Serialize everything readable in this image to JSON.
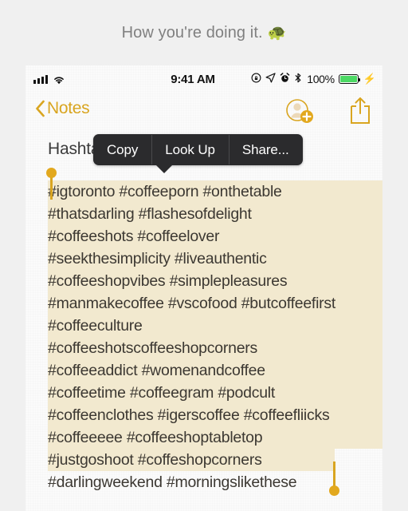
{
  "caption": {
    "text": "How you're doing it.",
    "emoji": "🐢",
    "emoji_name": "turtle-emoji",
    "color": "#808080"
  },
  "status_bar": {
    "time": "9:41 AM",
    "battery_percent": "100%",
    "icons": [
      "cellular-signal-icon",
      "wifi-icon",
      "rotation-lock-icon",
      "location-arrow-icon",
      "alarm-clock-icon",
      "bluetooth-icon",
      "battery-icon",
      "charging-bolt-icon"
    ],
    "battery_color": "#4cd964"
  },
  "nav_bar": {
    "back_label": "Notes",
    "back_icon": "chevron-left-icon",
    "add_person_icon": "add-person-icon",
    "share_icon": "share-icon",
    "accent_color": "#d9a520"
  },
  "note": {
    "title": "Hashtags",
    "title_visible": "Hasht",
    "text_color": "#3c3832",
    "highlight_color": "#f2e9cf",
    "lines": [
      "#igtoronto #coffeeporn #onthetable",
      "#thatsdarling #flashesofdelight",
      "#coffeeshots #coffeelover",
      "#seekthesimplicity #liveauthentic",
      "#coffeeshopvibes #simplepleasures",
      "#manmakecoffee #vscofood #butcoffeefirst",
      "#coffeeculture",
      "#coffeeshotscoffeeshopcorners",
      "#coffeeaddict #womenandcoffee",
      "#coffeetime #coffeegram #podcult",
      "#coffeenclothes #igerscoffee #coffeefliicks",
      "#coffeeeee #coffeeshoptabletop",
      "#justgoshoot #coffeshopcorners",
      "#darlingweekend #morningslikethese"
    ]
  },
  "context_menu": {
    "items": [
      {
        "label": "Copy",
        "name": "menu-item-copy"
      },
      {
        "label": "Look Up",
        "name": "menu-item-look-up"
      },
      {
        "label": "Share...",
        "name": "menu-item-share"
      }
    ],
    "background": "#2b2b2d"
  },
  "selection": {
    "start_handle": "selection-handle-start",
    "end_handle": "selection-handle-end",
    "handle_color": "#e2a81e"
  }
}
